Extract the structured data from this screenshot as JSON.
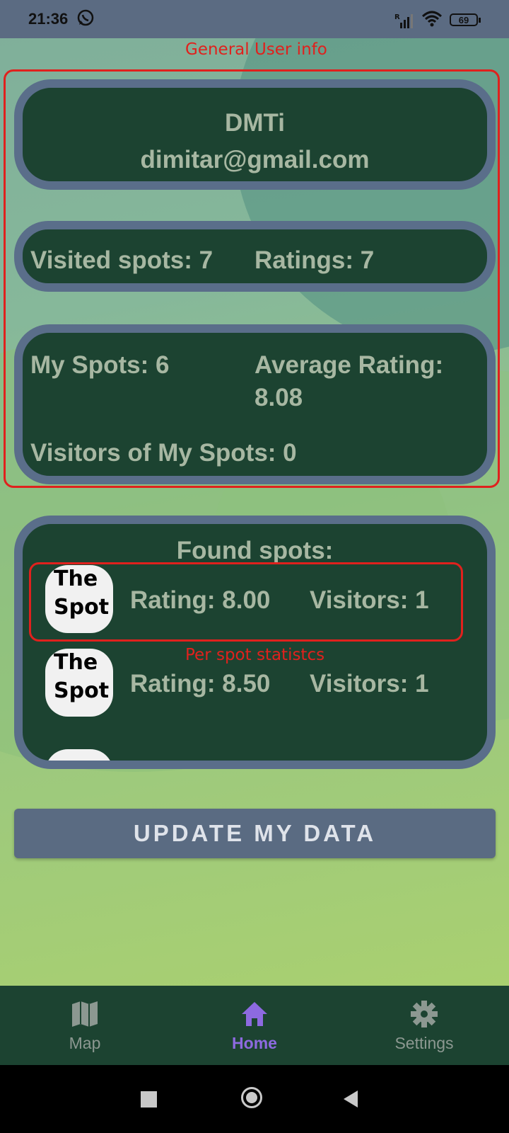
{
  "status_bar": {
    "time": "21:36",
    "battery": "69",
    "icons": [
      "whatsapp-icon",
      "signal-icon",
      "wifi-icon",
      "battery-icon"
    ]
  },
  "annotations": {
    "general": "General User info",
    "per_spot": "Per spot statistcs"
  },
  "user": {
    "name": "DMTi",
    "email": "dimitar@gmail.com"
  },
  "stats1": {
    "visited": "Visited spots: 7",
    "ratings": "Ratings: 7"
  },
  "stats2": {
    "my_spots": "My Spots: 6",
    "avg_rating_label": "Average Rating:",
    "avg_rating_value": "8.08",
    "visitors": "Visitors of My Spots: 0"
  },
  "found": {
    "title": "Found spots:",
    "spots": [
      {
        "logo_line1": "The",
        "logo_line2": "Spot",
        "rating": "Rating: 8.00",
        "visitors": "Visitors: 1"
      },
      {
        "logo_line1": "The",
        "logo_line2": "Spot",
        "rating": "Rating: 8.50",
        "visitors": "Visitors: 1"
      }
    ]
  },
  "update_button": "UPDATE MY DATA",
  "nav": {
    "items": [
      {
        "label": "Map",
        "icon": "map-icon"
      },
      {
        "label": "Home",
        "icon": "home-icon"
      },
      {
        "label": "Settings",
        "icon": "gear-icon"
      }
    ],
    "active": "Home"
  },
  "colors": {
    "card_bg": "#1c4331",
    "card_border": "#5a6e8a",
    "card_text": "#a7b7a2",
    "annotation": "#e0211d",
    "nav_active": "#8d6ae0",
    "button_bg": "#5a6b82"
  }
}
